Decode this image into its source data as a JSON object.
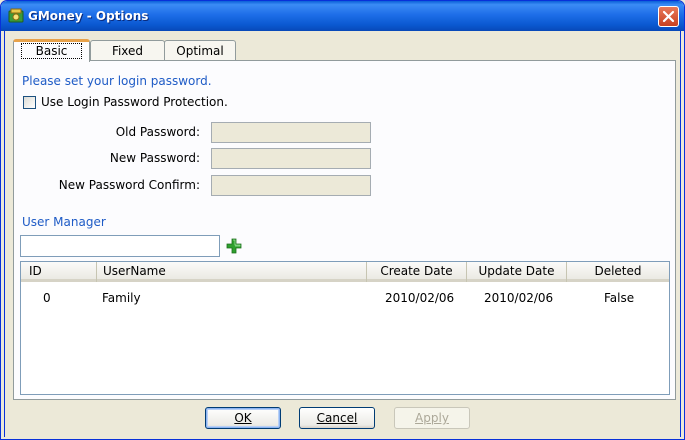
{
  "window": {
    "title": "GMoney - Options"
  },
  "tabs": [
    {
      "label": "Basic",
      "active": true
    },
    {
      "label": "Fixed",
      "active": false
    },
    {
      "label": "Optimal",
      "active": false
    }
  ],
  "password": {
    "prompt": "Please set your login password.",
    "checkbox_label": "Use Login Password Protection.",
    "checked": false,
    "old_label": "Old Password:",
    "new_label": "New Password:",
    "confirm_label": "New Password Confirm:"
  },
  "user_manager": {
    "title": "User Manager",
    "search_value": "",
    "columns": [
      "ID",
      "UserName",
      "Create Date",
      "Update Date",
      "Deleted"
    ],
    "rows": [
      {
        "id": "0",
        "username": "Family",
        "create_date": "2010/02/06",
        "update_date": "2010/02/06",
        "deleted": "False"
      }
    ]
  },
  "buttons": {
    "ok": "OK",
    "cancel": "Cancel",
    "apply": "Apply"
  },
  "icons": {
    "app": "money-app-icon",
    "close": "close-icon",
    "add": "plus-icon"
  },
  "colors": {
    "titlebar": "#0a58d0",
    "accent_label": "#1e5bc6",
    "add_icon": "#2ea02e",
    "close_button": "#d9532f"
  }
}
